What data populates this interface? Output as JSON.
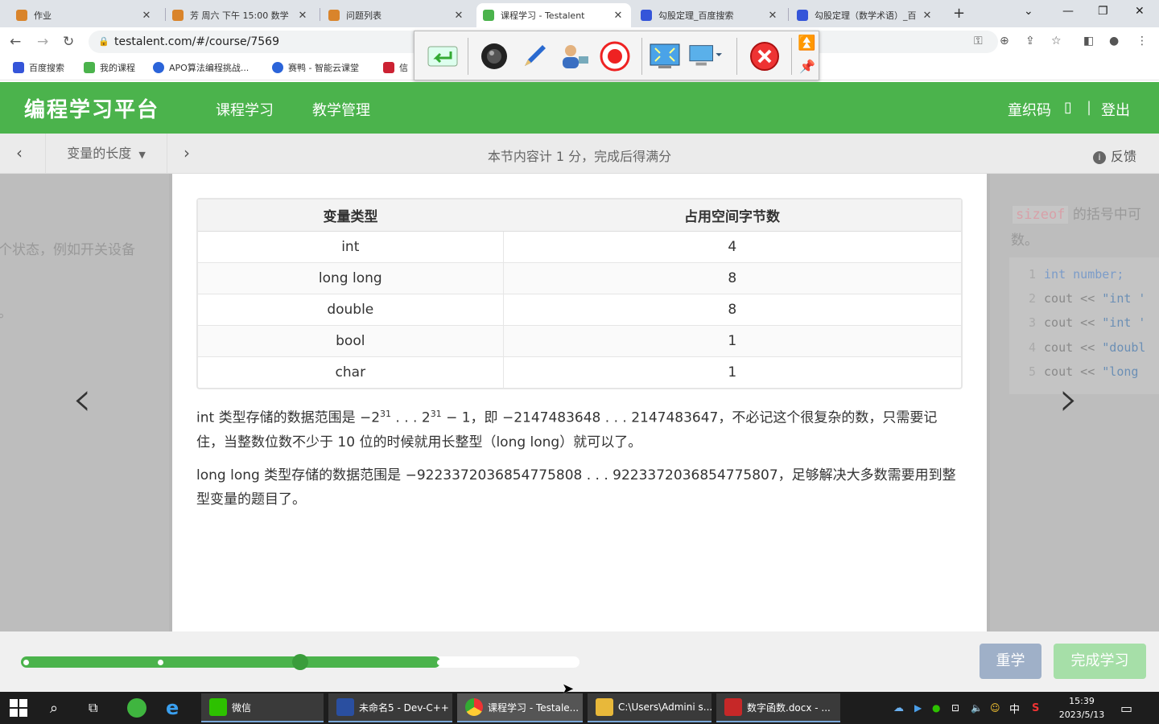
{
  "browser": {
    "tabs": [
      {
        "title": "作业",
        "color": "#d9842b"
      },
      {
        "title": "芳 周六 下午 15:00 数学",
        "color": "#d9842b"
      },
      {
        "title": "问题列表",
        "color": "#d9842b"
      },
      {
        "title": "课程学习 - Testalent",
        "color": "#4bb34c"
      },
      {
        "title": "勾股定理_百度搜索",
        "color": "#3555d9"
      },
      {
        "title": "勾股定理（数学术语）_百",
        "color": "#3555d9"
      }
    ],
    "url": "testalent.com/#/course/7569",
    "bookmarks": [
      {
        "label": "百度搜索",
        "color": "#3555d9"
      },
      {
        "label": "我的课程",
        "color": "#4bb34c"
      },
      {
        "label": "APO算法编程挑战...",
        "color": "#2b64d9"
      },
      {
        "label": "赛鸭 - 智能云课堂",
        "color": "#2b64d9"
      },
      {
        "label": "信",
        "color": "#c23"
      }
    ]
  },
  "site": {
    "logo": "编程学习平台",
    "nav": [
      "课程学习",
      "教学管理"
    ],
    "user_name": "童织码",
    "user_glyph": "▯",
    "divider": "|",
    "logout": "登出"
  },
  "subbar": {
    "section": "变量的长度",
    "notice": "本节内容计 1 分，完成后得满分",
    "feedback": "反馈"
  },
  "content": {
    "table": {
      "headers": [
        "变量类型",
        "占用空间字节数"
      ],
      "rows": [
        [
          "int",
          "4"
        ],
        [
          "long long",
          "8"
        ],
        [
          "double",
          "8"
        ],
        [
          "bool",
          "1"
        ],
        [
          "char",
          "1"
        ]
      ]
    },
    "para1": {
      "t1": "int 类型存储的数据范围是 −2",
      "sup1": "31",
      "t2": " . . . 2",
      "sup2": "31",
      "t3": " − 1，即 −2147483648 . . . 2147483647，不必记这个很复杂的数，只需要记住，当整数位数不少于 10 位的时候就用长整型（long long）就可以了。"
    },
    "para2": "long long 类型存储的数据范围是 −9223372036854775808 . . . 9223372036854775807，足够解决大多数需要用到整型变量的题目了。"
  },
  "ghost_left": {
    "line1": "个状态，例如开关设备",
    "line2": "。"
  },
  "ghost_right": {
    "keyword": "sizeof",
    "text1": " 的括号中可",
    "text2": "数。",
    "code": [
      {
        "n": "1",
        "pre": "int number;",
        "str": ""
      },
      {
        "n": "2",
        "pre": "cout << ",
        "str": "\"int '"
      },
      {
        "n": "3",
        "pre": "cout << ",
        "str": "\"int '"
      },
      {
        "n": "4",
        "pre": "cout << ",
        "str": "\"doubl"
      },
      {
        "n": "5",
        "pre": "cout << ",
        "str": "\"long"
      }
    ]
  },
  "footer": {
    "progress": 0.75,
    "relearn": "重学",
    "complete": "完成学习"
  },
  "taskbar": {
    "apps": [
      {
        "label": "微信",
        "color": "#2dc100"
      },
      {
        "label": "未命名5 - Dev-C++",
        "color": "#2a4fa0"
      },
      {
        "label": "课程学习 - Testale...",
        "color": "#e0a020"
      },
      {
        "label": "C:\\Users\\Admini s...",
        "color": "#e8b83a"
      },
      {
        "label": "数字函数.docx - ...",
        "color": "#c62828"
      }
    ],
    "tray_lang": "中",
    "time": "15:39",
    "date": "2023/5/13"
  }
}
